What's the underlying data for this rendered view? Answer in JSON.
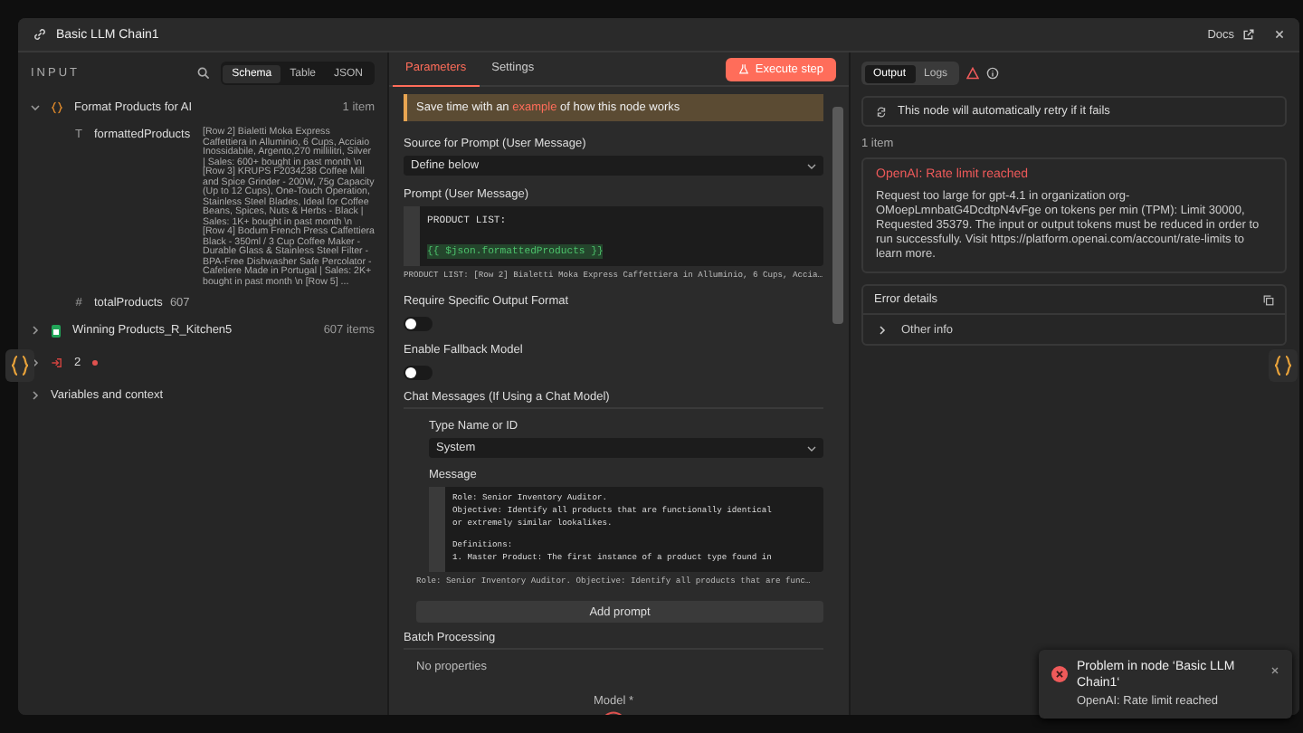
{
  "window": {
    "title": "Basic LLM Chain1",
    "docs": "Docs"
  },
  "input": {
    "heading": "INPUT",
    "view_tabs": [
      {
        "label": "Schema",
        "selected": true
      },
      {
        "label": "Table",
        "selected": false
      },
      {
        "label": "JSON",
        "selected": false
      }
    ],
    "nodes": [
      {
        "kind": "code",
        "name": "Format Products for AI",
        "count": "1 item",
        "expanded": true,
        "fields": [
          {
            "type_icon": "T",
            "name": "formattedProducts",
            "value": "[Row 2] Bialetti Moka Express Caffettiera in Alluminio, 6 Cups, Acciaio Inossidabile, Argento,270 millilitri, Silver | Sales: 600+ bought in past month \\n [Row 3] KRUPS F2034238 Coffee Mill and Spice Grinder - 200W, 75g Capacity (Up to 12 Cups), One-Touch Operation, Stainless Steel Blades, Ideal for Coffee Beans, Spices, Nuts & Herbs - Black | Sales: 1K+ bought in past month \\n [Row 4] Bodum French Press Caffettiera Black - 350ml / 3 Cup Coffee Maker - Durable Glass & Stainless Steel Filter - BPA-Free Dishwasher Safe Percolator - Cafetiere Made in Portugal | Sales: 2K+ bought in past month \\n [Row 5] ..."
          },
          {
            "type_icon": "#",
            "name": "totalProducts",
            "value": "607"
          }
        ]
      },
      {
        "kind": "sheet",
        "name": "Winning Products_R_Kitchen5",
        "count": "607 items",
        "expanded": false
      },
      {
        "kind": "trigger",
        "name": "2",
        "expanded": false,
        "color": "#e0524f"
      }
    ],
    "variables": {
      "label": "Variables and context",
      "expanded": false
    }
  },
  "parameters": {
    "tabs": [
      {
        "label": "Parameters",
        "selected": true
      },
      {
        "label": "Settings",
        "selected": false
      }
    ],
    "execute_button": "Execute step",
    "notice": {
      "before": "Save time with an",
      "link": "example",
      "after": "of how this node works"
    },
    "source": {
      "label": "Source for Prompt (User Message)",
      "value": "Define below"
    },
    "prompt": {
      "label": "Prompt (User Message)",
      "lines": [
        {
          "kind": "text",
          "text": "PRODUCT LIST:"
        },
        {
          "kind": "expression",
          "text": "{{ $json.formattedProducts }}"
        }
      ],
      "preview": "PRODUCT LIST: [Row 2] Bialetti Moka Express Caffettiera in Alluminio, 6 Cups, Accia…"
    },
    "toggles": [
      {
        "label": "Require Specific Output Format",
        "on": false
      },
      {
        "label": "Enable Fallback Model",
        "on": false
      }
    ],
    "chat": {
      "heading": "Chat Messages (If Using a Chat Model)",
      "type_label": "Type Name or ID",
      "type_value": "System",
      "message_label": "Message",
      "message_lines": [
        "Role: Senior Inventory Auditor.",
        "Objective: Identify all products that are functionally identical",
        "or extremely similar lookalikes.",
        "Definitions:",
        "1. Master Product: The first instance of a product type found in"
      ],
      "preview": "Role: Senior Inventory Auditor. Objective: Identify all products that are func…",
      "add_button": "Add prompt"
    },
    "batch": {
      "heading": "Batch Processing",
      "empty": "No properties"
    },
    "model_label": "Model *"
  },
  "output": {
    "tabs": [
      {
        "label": "Output",
        "selected": true
      },
      {
        "label": "Logs",
        "selected": false
      }
    ],
    "retry_notice": "This node will automatically retry if it fails",
    "count": "1 item",
    "error": {
      "title": "OpenAI: Rate limit reached",
      "message": "Request too large for gpt-4.1 in organization org-OMoepLmnbatG4DcdtpN4vFge on tokens per min (TPM): Limit 30000, Requested 35379. The input or output tokens must be reduced in order to run successfully. Visit https://platform.openai.com/account/rate-limits to learn more."
    },
    "details": {
      "heading": "Error details",
      "other": "Other info",
      "expanded": false
    }
  },
  "toast": {
    "title": "Problem in node ‘Basic LLM Chain1‘",
    "message": "OpenAI: Rate limit reached"
  }
}
